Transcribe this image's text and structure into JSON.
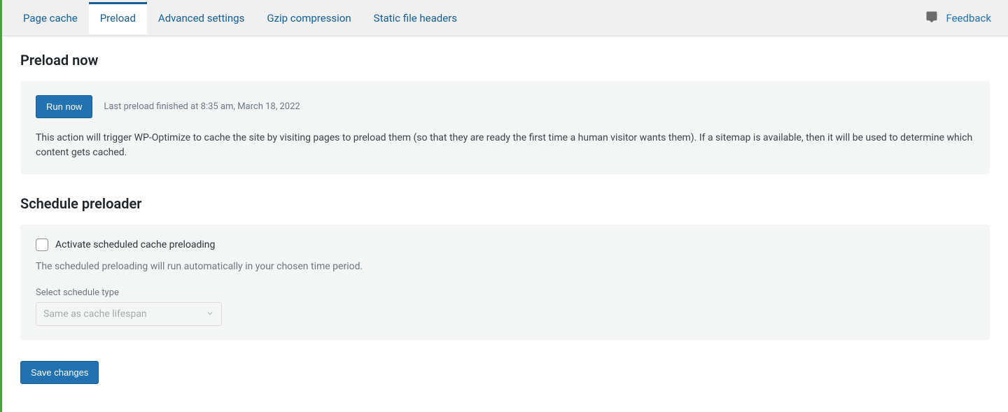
{
  "tabs": {
    "items": [
      {
        "label": "Page cache",
        "active": false
      },
      {
        "label": "Preload",
        "active": true
      },
      {
        "label": "Advanced settings",
        "active": false
      },
      {
        "label": "Gzip compression",
        "active": false
      },
      {
        "label": "Static file headers",
        "active": false
      }
    ],
    "feedback_label": "Feedback"
  },
  "preload_now": {
    "heading": "Preload now",
    "button": "Run now",
    "status": "Last preload finished at 8:35 am, March 18, 2022",
    "description": "This action will trigger WP-Optimize to cache the site by visiting pages to preload them (so that they are ready the first time a human visitor wants them). If a sitemap is available, then it will be used to determine which content gets cached."
  },
  "schedule": {
    "heading": "Schedule preloader",
    "checkbox_label": "Activate scheduled cache preloading",
    "checkbox_checked": false,
    "description": "The scheduled preloading will run automatically in your chosen time period.",
    "select_label": "Select schedule type",
    "select_value": "Same as cache lifespan"
  },
  "save_button": "Save changes"
}
